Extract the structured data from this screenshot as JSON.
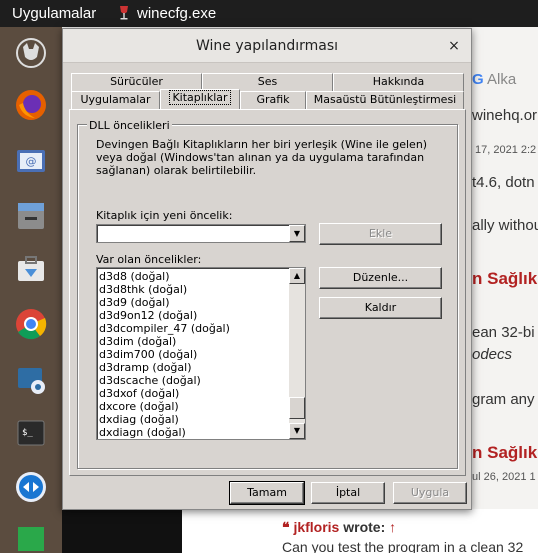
{
  "topbar": {
    "apps_label": "Uygulamalar",
    "window_title": "winecfg.exe"
  },
  "dock": {
    "items": [
      "wine-icon",
      "firefox-icon",
      "mail-icon",
      "file-manager-icon",
      "software-store-icon",
      "chrome-icon",
      "screenshot-icon",
      "terminal-icon",
      "teamviewer-icon",
      "app-icon"
    ]
  },
  "browser": {
    "tab_text": "Alka",
    "url": "winehq.or",
    "date1": "17, 2021 2:2",
    "line1": "t4.6, dotn",
    "line2": "ally withou",
    "heading1": "n Sağlık",
    "line3": "ean 32-bi",
    "line4": "odecs",
    "line5": "gram any",
    "heading2": "n Sağlık",
    "date2": "ul 26, 2021 1",
    "author": "jkfloris",
    "wrote": "wrote:",
    "bottom_line": "Can you test the program in a clean 32"
  },
  "dialog": {
    "title": "Wine yapılandırması",
    "close": "×",
    "tabs_row1": [
      "Sürücüler",
      "Ses",
      "Hakkında"
    ],
    "tabs_row2": [
      "Uygulamalar",
      "Kitaplıklar",
      "Grafik",
      "Masaüstü Bütünleştirmesi"
    ],
    "active_tab": "Kitaplıklar",
    "group_title": "DLL öncelikleri",
    "description": "Devingen Bağlı Kitaplıkların her biri yerleşik (Wine ile gelen) veya doğal (Windows'tan alınan ya da uygulama tarafından sağlanan) olarak belirtilebilir.",
    "new_override_label": "Kitaplık için yeni öncelik:",
    "new_override_value": "",
    "add_button": "Ekle",
    "existing_label": "Var olan öncelikler:",
    "overrides": [
      "d3d8 (doğal)",
      "d3d8thk (doğal)",
      "d3d9 (doğal)",
      "d3d9on12 (doğal)",
      "d3dcompiler_47 (doğal)",
      "d3dim (doğal)",
      "d3dim700 (doğal)",
      "d3dramp (doğal)",
      "d3dscache (doğal)",
      "d3dxof (doğal)",
      "dxcore (doğal)",
      "dxdiag (doğal)",
      "dxdiagn (doğal)"
    ],
    "edit_button": "Düzenle...",
    "remove_button": "Kaldır",
    "ok_button": "Tamam",
    "cancel_button": "İptal",
    "apply_button": "Uygula"
  }
}
